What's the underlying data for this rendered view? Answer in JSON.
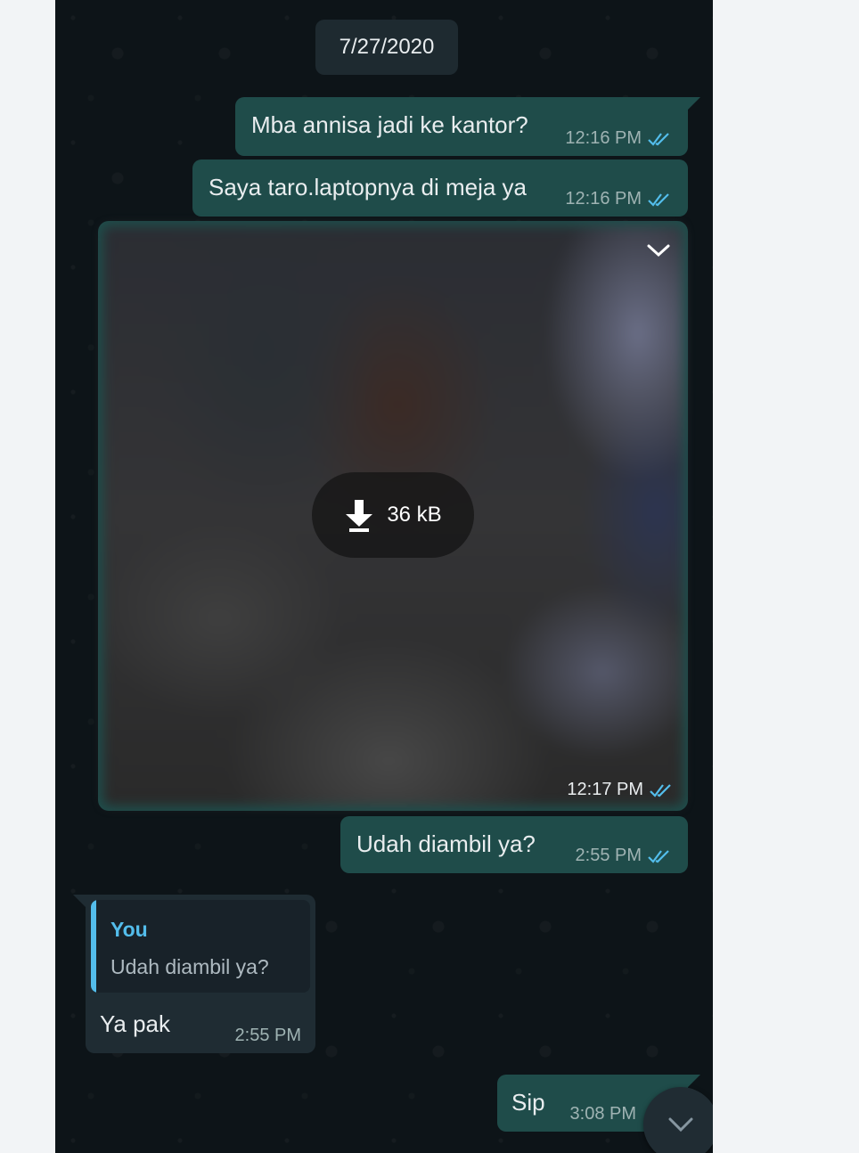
{
  "date_separator": "7/27/2020",
  "messages": [
    {
      "text": "Mba annisa jadi ke kantor?",
      "time": "12:16 PM",
      "status": "read"
    },
    {
      "text": "Saya taro.laptopnya di meja ya",
      "time": "12:16 PM",
      "status": "read"
    },
    {
      "type": "image",
      "download_size": "36 kB",
      "time": "12:17 PM",
      "status": "read"
    },
    {
      "text": "Udah diambil ya?",
      "time": "2:55 PM",
      "status": "read"
    },
    {
      "text": "Ya pak",
      "time": "2:55 PM",
      "quote": {
        "author": "You",
        "text": "Udah diambil ya?"
      }
    },
    {
      "text": "Sip",
      "time": "3:08 PM",
      "status": "read"
    }
  ],
  "colors": {
    "chat_background": "#0d1418",
    "outgoing_bubble": "#1f4c4a",
    "incoming_bubble": "#1f2c33",
    "read_ticks": "#53bdeb",
    "quote_accent": "#53bdeb"
  },
  "icons": {
    "read_ticks": "double-check-icon",
    "image_menu": "chevron-down-icon",
    "download": "download-arrow-icon",
    "scroll_down": "chevron-down-icon"
  }
}
